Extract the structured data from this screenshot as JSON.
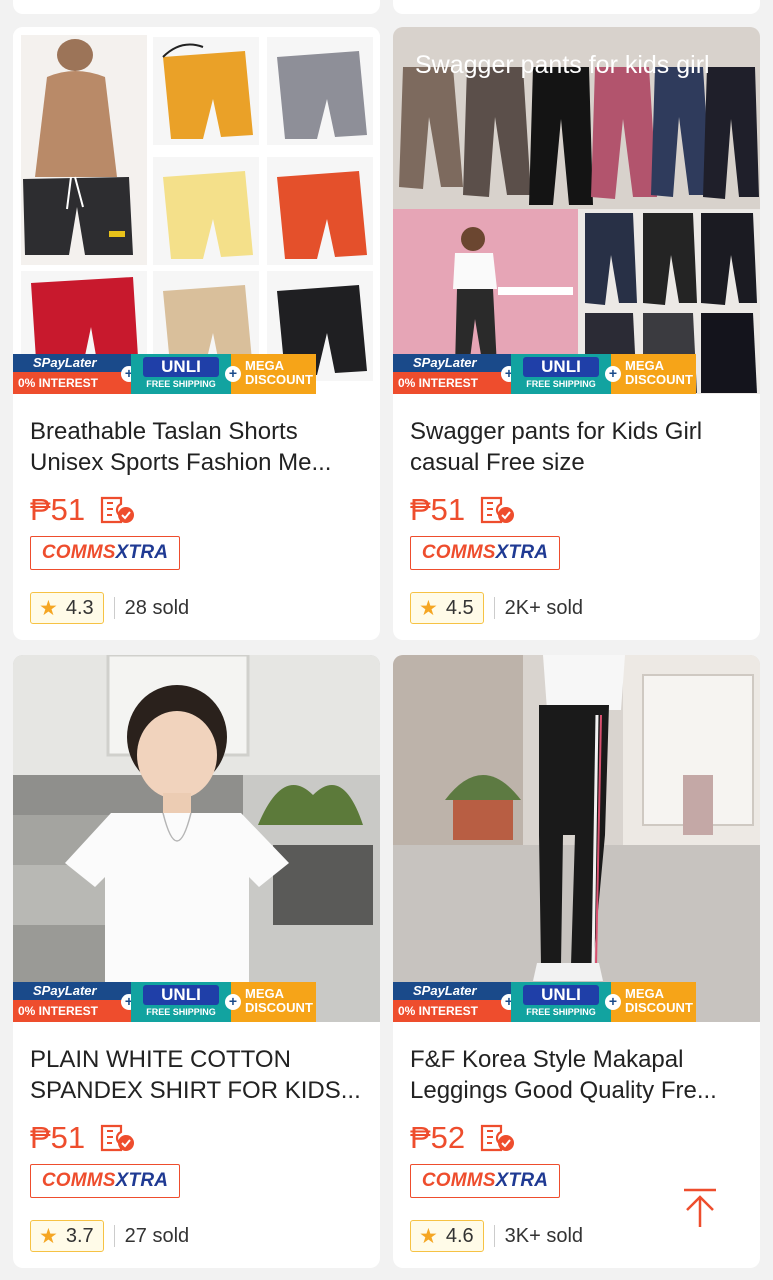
{
  "banner": {
    "spaylater": "SPayLater",
    "interest": "0% INTEREST",
    "unli": "UNLI",
    "free_shipping": "FREE SHIPPING",
    "mega": "MEGA",
    "discount": "DISCOUNT"
  },
  "products": [
    {
      "title_line1": "Breathable Taslan  Shorts",
      "title_line2": "Unisex Sports Fashion Me...",
      "price": "₱51",
      "badge_a": "COMMS",
      "badge_b": "XTRA",
      "rating": "4.3",
      "sold": "28 sold",
      "image_icon": "shorts-collage-image"
    },
    {
      "title_line1": "Swagger pants for Kids Girl",
      "title_line2": "casual Free size",
      "price": "₱51",
      "badge_a": "COMMS",
      "badge_b": "XTRA",
      "rating": "4.5",
      "sold": "2K+ sold",
      "image_overlay": "Swagger pants for kids girl",
      "image_icon": "pants-collage-image"
    },
    {
      "title_line1": "PLAIN WHITE COTTON",
      "title_line2": "SPANDEX SHIRT FOR KIDS...",
      "price": "₱51",
      "badge_a": "COMMS",
      "badge_b": "XTRA",
      "rating": "3.7",
      "sold": "27 sold",
      "image_icon": "boy-white-shirt-image"
    },
    {
      "title_line1": "F&F Korea Style Makapal",
      "title_line2": "Leggings Good Quality Fre...",
      "price": "₱52",
      "badge_a": "COMMS",
      "badge_b": "XTRA",
      "rating": "4.6",
      "sold": "3K+ sold",
      "image_icon": "leggings-photo-image"
    }
  ],
  "colors": {
    "accent": "#ee4d2d",
    "navy": "#1f3a93",
    "star": "#f5a623"
  }
}
